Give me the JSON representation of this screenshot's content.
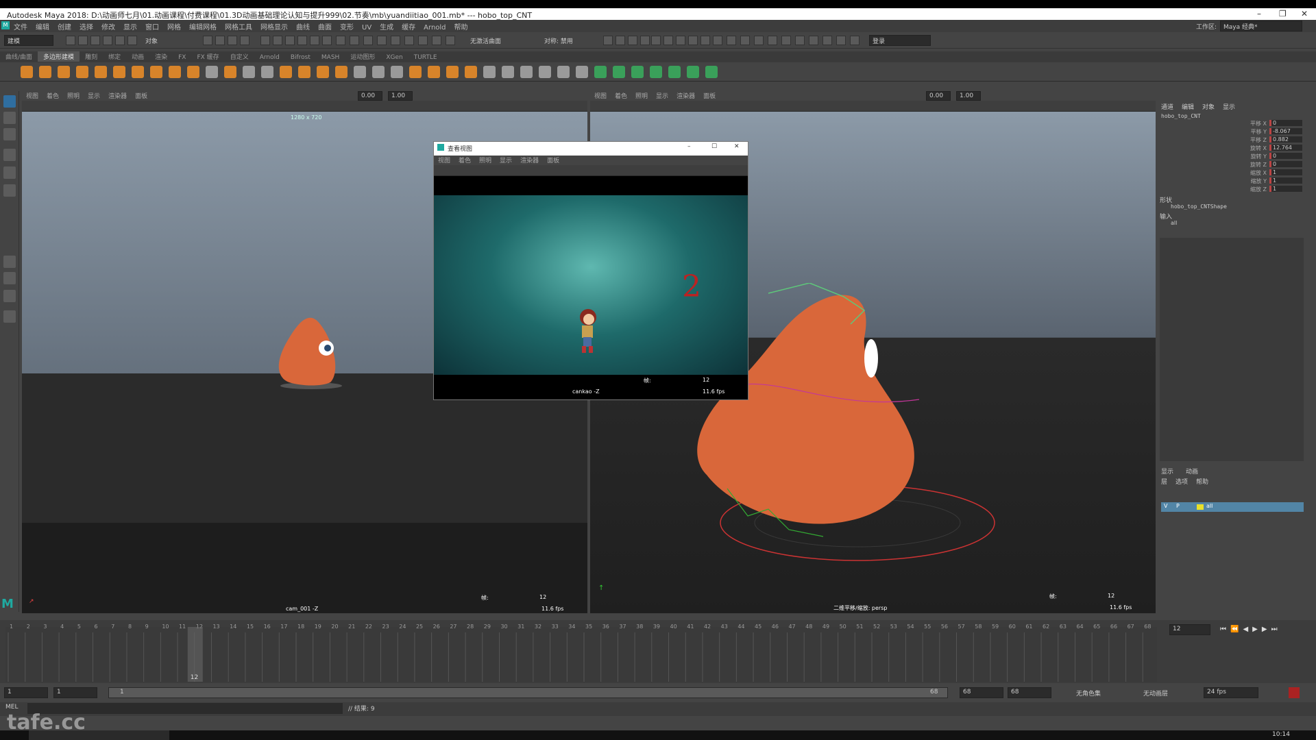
{
  "window": {
    "app_title": "Autodesk Maya 2018: D:\\动画师七月\\01.动画课程\\付费课程\\01.3D动画基础理论认知与提升999\\02.节奏\\mb\\yuandiitiao_001.mb*   ---   hobo_top_CNT",
    "controls": [
      "–",
      "❐",
      "✕"
    ]
  },
  "menubar": {
    "items": [
      "文件",
      "编辑",
      "创建",
      "选择",
      "修改",
      "显示",
      "窗口",
      "网格",
      "编辑网格",
      "网格工具",
      "网格显示",
      "曲线",
      "曲面",
      "变形",
      "UV",
      "生成",
      "缓存",
      "Arnold",
      "帮助"
    ],
    "workspace_label": "工作区:",
    "workspace_value": "Maya 经典*"
  },
  "statusline": {
    "mode": "建模",
    "object_label": "对象",
    "no_live": "无激活曲面",
    "symmetry": "对称: 禁用",
    "login": "登录"
  },
  "shelf": {
    "tabs": [
      "曲线/曲面",
      "多边形建模",
      "雕刻",
      "绑定",
      "动画",
      "渲染",
      "FX",
      "FX 缓存",
      "自定义",
      "Arnold",
      "Bifrost",
      "MASH",
      "运动图形",
      "XGen",
      "TURTLE"
    ],
    "active_tab": 1
  },
  "panel_menu": [
    "视图",
    "着色",
    "照明",
    "显示",
    "渲染器",
    "面板"
  ],
  "left_viewport": {
    "resolution": "1280 x 720",
    "camera": "cam_001 -Z",
    "frame_label": "帧:",
    "frame": "12",
    "fps": "11.6 fps",
    "field1": "0.00",
    "field2": "1.00"
  },
  "right_viewport": {
    "camera": "二维平移/缩放: persp",
    "frame_label": "帧:",
    "frame": "12",
    "fps": "11.6 fps",
    "field1": "0.00",
    "field2": "1.00"
  },
  "camera_window": {
    "title": "查看视图",
    "menu": [
      "视图",
      "着色",
      "照明",
      "显示",
      "渲染器",
      "面板"
    ],
    "camera": "cankao -Z",
    "frame_label": "帧:",
    "frame": "12",
    "fps": "11.6 fps",
    "drawn_number": "2"
  },
  "channel_box": {
    "tabs": [
      "通道",
      "编辑",
      "对象",
      "显示"
    ],
    "object": "hobo_top_CNT",
    "attrs": [
      {
        "label": "平移 X",
        "value": "0"
      },
      {
        "label": "平移 Y",
        "value": "-8.067"
      },
      {
        "label": "平移 Z",
        "value": "0.882"
      },
      {
        "label": "旋转 X",
        "value": "12.764"
      },
      {
        "label": "旋转 Y",
        "value": "0"
      },
      {
        "label": "旋转 Z",
        "value": "0"
      },
      {
        "label": "缩放 X",
        "value": "1"
      },
      {
        "label": "缩放 Y",
        "value": "1"
      },
      {
        "label": "缩放 Z",
        "value": "1"
      }
    ],
    "shapes_header": "形状",
    "shape_name": "hobo_top_CNTShape",
    "inputs_header": "输入",
    "input_name": "all",
    "layer_tabs": [
      "显示",
      "动画"
    ],
    "layer_menu": [
      "层",
      "选项",
      "帮助"
    ],
    "layer": {
      "v": "V",
      "p": "P",
      "name": "all"
    }
  },
  "timeline": {
    "ticks": [
      "1",
      "2",
      "3",
      "4",
      "5",
      "6",
      "7",
      "8",
      "9",
      "10",
      "11",
      "12",
      "13",
      "14",
      "15",
      "16",
      "17",
      "18",
      "19",
      "20",
      "21",
      "22",
      "23",
      "24",
      "25",
      "26",
      "27",
      "28",
      "29",
      "30",
      "31",
      "32",
      "33",
      "34",
      "35",
      "36",
      "37",
      "38",
      "39",
      "40",
      "41",
      "42",
      "43",
      "44",
      "45",
      "46",
      "47",
      "48",
      "49",
      "50",
      "51",
      "52",
      "53",
      "54",
      "55",
      "56",
      "57",
      "58",
      "59",
      "60",
      "61",
      "62",
      "63",
      "64",
      "65",
      "66",
      "67",
      "68"
    ],
    "current": "12",
    "current_frame_field": "12"
  },
  "range": {
    "start": "1",
    "start2": "1",
    "slider_start": "1",
    "slider_end": "68",
    "end": "68",
    "end2": "68",
    "no_char": "无角色集",
    "no_anim": "无动画层",
    "fps": "24 fps"
  },
  "cmdline": {
    "lang": "MEL",
    "result": "// 结果: 9"
  },
  "watermark": "tafe.cc",
  "clock": "10:14"
}
